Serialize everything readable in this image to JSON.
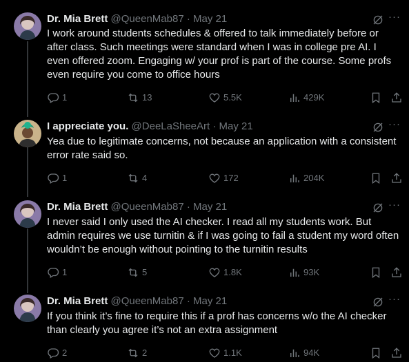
{
  "tweets": [
    {
      "name": "Dr. Mia Brett",
      "handle": "@QueenMab87",
      "sep": "·",
      "date": "May 21",
      "text": "I work around students schedules & offered to talk immediately before or after class. Such meetings were standard when I was in college pre AI. I even offered zoom. Engaging w/ your prof is part of the course. Some profs even require you come to office hours",
      "replies": "1",
      "reposts": "13",
      "likes": "5.5K",
      "views": "429K"
    },
    {
      "name": "I appreciate you.",
      "handle": "@DeeLaSheeArt",
      "sep": "·",
      "date": "May 21",
      "text": "Yea due to legitimate concerns, not because an application with a consistent error rate said so.",
      "replies": "1",
      "reposts": "4",
      "likes": "172",
      "views": "204K"
    },
    {
      "name": "Dr. Mia Brett",
      "handle": "@QueenMab87",
      "sep": "·",
      "date": "May 21",
      "text": "I never said I only used the AI checker. I read all my students work. But admin requires we use turnitin & if I was going to fail a student my word often wouldn’t be enough without pointing to the turnitin results",
      "replies": "1",
      "reposts": "5",
      "likes": "1.8K",
      "views": "93K"
    },
    {
      "name": "Dr. Mia Brett",
      "handle": "@QueenMab87",
      "sep": "·",
      "date": "May 21",
      "text": "If you think it’s fine to require this if a prof has concerns w/o the AI checker than clearly you agree it’s not an extra assignment",
      "replies": "2",
      "reposts": "2",
      "likes": "1.1K",
      "views": "94K"
    }
  ],
  "more_glyph": "···",
  "colors": {
    "background": "#000000",
    "text": "#e7e9ea",
    "muted": "#71767b",
    "divider": "#2f3336"
  }
}
